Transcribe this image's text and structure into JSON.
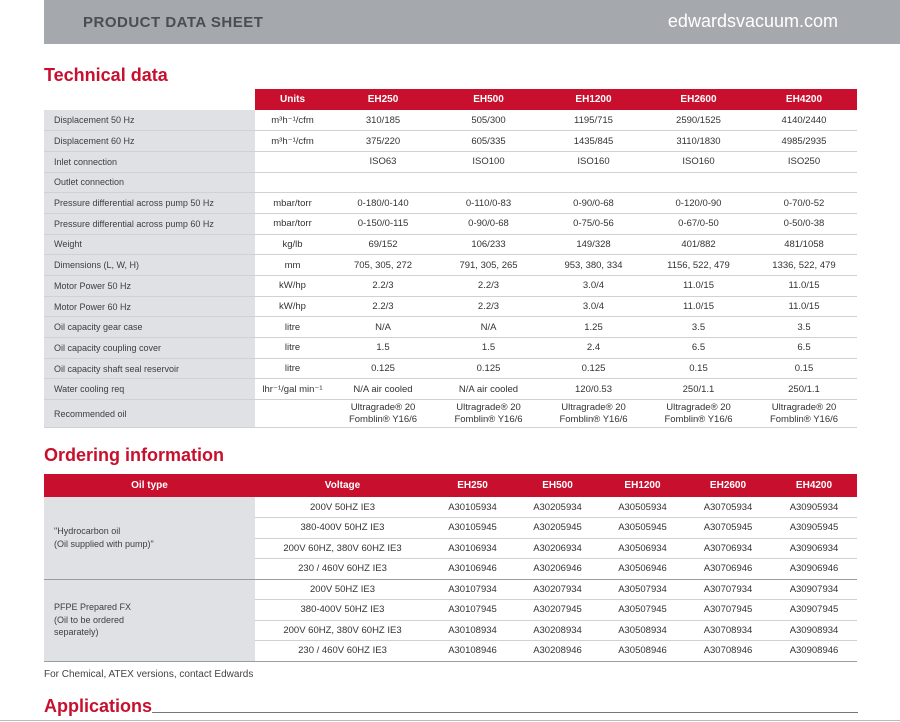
{
  "header": {
    "doc_type": "PRODUCT DATA SHEET",
    "site": "edwardsvacuum.com"
  },
  "technical": {
    "title": "Technical data",
    "columns": [
      "Units",
      "EH250",
      "EH500",
      "EH1200",
      "EH2600",
      "EH4200"
    ],
    "rows": [
      {
        "label": "Displacement 50 Hz",
        "units": "m³h⁻¹/cfm",
        "values": [
          "310/185",
          "505/300",
          "1195/715",
          "2590/1525",
          "4140/2440"
        ]
      },
      {
        "label": "Displacement 60 Hz",
        "units": "m³h⁻¹/cfm",
        "values": [
          "375/220",
          "605/335",
          "1435/845",
          "3110/1830",
          "4985/2935"
        ]
      },
      {
        "label": "Inlet connection",
        "units": "",
        "values": [
          "ISO63",
          "ISO100",
          "ISO160",
          "ISO160",
          "ISO250"
        ]
      },
      {
        "label": "Outlet connection",
        "units": "",
        "values": [
          "",
          "",
          "",
          "",
          ""
        ]
      },
      {
        "label": "Pressure differential across pump 50 Hz",
        "units": "mbar/torr",
        "values": [
          "0-180/0-140",
          "0-110/0-83",
          "0-90/0-68",
          "0-120/0-90",
          "0-70/0-52"
        ]
      },
      {
        "label": "Pressure differential across pump 60 Hz",
        "units": "mbar/torr",
        "values": [
          "0-150/0-115",
          "0-90/0-68",
          "0-75/0-56",
          "0-67/0-50",
          "0-50/0-38"
        ]
      },
      {
        "label": "Weight",
        "units": "kg/lb",
        "values": [
          "69/152",
          "106/233",
          "149/328",
          "401/882",
          "481/1058"
        ]
      },
      {
        "label": "Dimensions (L, W, H)",
        "units": "mm",
        "values": [
          "705, 305, 272",
          "791, 305, 265",
          "953, 380, 334",
          "1156, 522, 479",
          "1336, 522, 479"
        ]
      },
      {
        "label": "Motor Power 50 Hz",
        "units": "kW/hp",
        "values": [
          "2.2/3",
          "2.2/3",
          "3.0/4",
          "11.0/15",
          "11.0/15"
        ]
      },
      {
        "label": "Motor Power 60 Hz",
        "units": "kW/hp",
        "values": [
          "2.2/3",
          "2.2/3",
          "3.0/4",
          "11.0/15",
          "11.0/15"
        ]
      },
      {
        "label": "Oil capacity gear case",
        "units": "litre",
        "values": [
          "N/A",
          "N/A",
          "1.25",
          "3.5",
          "3.5"
        ]
      },
      {
        "label": "Oil capacity coupling cover",
        "units": "litre",
        "values": [
          "1.5",
          "1.5",
          "2.4",
          "6.5",
          "6.5"
        ]
      },
      {
        "label": "Oil capacity shaft seal reservoir",
        "units": "litre",
        "values": [
          "0.125",
          "0.125",
          "0.125",
          "0.15",
          "0.15"
        ]
      },
      {
        "label": "Water cooling req",
        "units": "lhr⁻¹/gal min⁻¹",
        "values": [
          "N/A air cooled",
          "N/A air cooled",
          "120/0.53",
          "250/1.1",
          "250/1.1"
        ]
      },
      {
        "label": "Recommended oil",
        "units": "",
        "values": [
          "Ultragrade® 20\nFomblin® Y16/6",
          "Ultragrade® 20\nFomblin® Y16/6",
          "Ultragrade® 20\nFomblin® Y16/6",
          "Ultragrade® 20\nFomblin® Y16/6",
          "Ultragrade® 20\nFomblin® Y16/6"
        ]
      }
    ]
  },
  "ordering": {
    "title": "Ordering information",
    "columns": [
      "Oil type",
      "Voltage",
      "EH250",
      "EH500",
      "EH1200",
      "EH2600",
      "EH4200"
    ],
    "groups": [
      {
        "oil": "\"Hydrocarbon oil\n (Oil supplied with pump)\"",
        "rows": [
          {
            "voltage": "200V 50HZ IE3",
            "codes": [
              "A30105934",
              "A30205934",
              "A30505934",
              "A30705934",
              "A30905934"
            ]
          },
          {
            "voltage": "380-400V 50HZ IE3",
            "codes": [
              "A30105945",
              "A30205945",
              "A30505945",
              "A30705945",
              "A30905945"
            ]
          },
          {
            "voltage": "200V 60HZ, 380V 60HZ IE3",
            "codes": [
              "A30106934",
              "A30206934",
              "A30506934",
              "A30706934",
              "A30906934"
            ]
          },
          {
            "voltage": "230 / 460V 60HZ IE3",
            "codes": [
              "A30106946",
              "A30206946",
              "A30506946",
              "A30706946",
              "A30906946"
            ]
          }
        ]
      },
      {
        "oil": "PFPE Prepared FX\n (Oil to be ordered\n separately)",
        "rows": [
          {
            "voltage": "200V 50HZ IE3",
            "codes": [
              "A30107934",
              "A30207934",
              "A30507934",
              "A30707934",
              "A30907934"
            ]
          },
          {
            "voltage": "380-400V 50HZ IE3",
            "codes": [
              "A30107945",
              "A30207945",
              "A30507945",
              "A30707945",
              "A30907945"
            ]
          },
          {
            "voltage": "200V 60HZ, 380V 60HZ IE3",
            "codes": [
              "A30108934",
              "A30208934",
              "A30508934",
              "A30708934",
              "A30908934"
            ]
          },
          {
            "voltage": "230 / 460V 60HZ IE3",
            "codes": [
              "A30108946",
              "A30208946",
              "A30508946",
              "A30708946",
              "A30908946"
            ]
          }
        ]
      }
    ]
  },
  "footnote": "For Chemical, ATEX versions, contact Edwards",
  "applications": {
    "title": "Applications"
  },
  "colors": {
    "accent": "#c8102e",
    "header_bar": "#a5a8ad",
    "label_bg": "#dfe1e4"
  }
}
